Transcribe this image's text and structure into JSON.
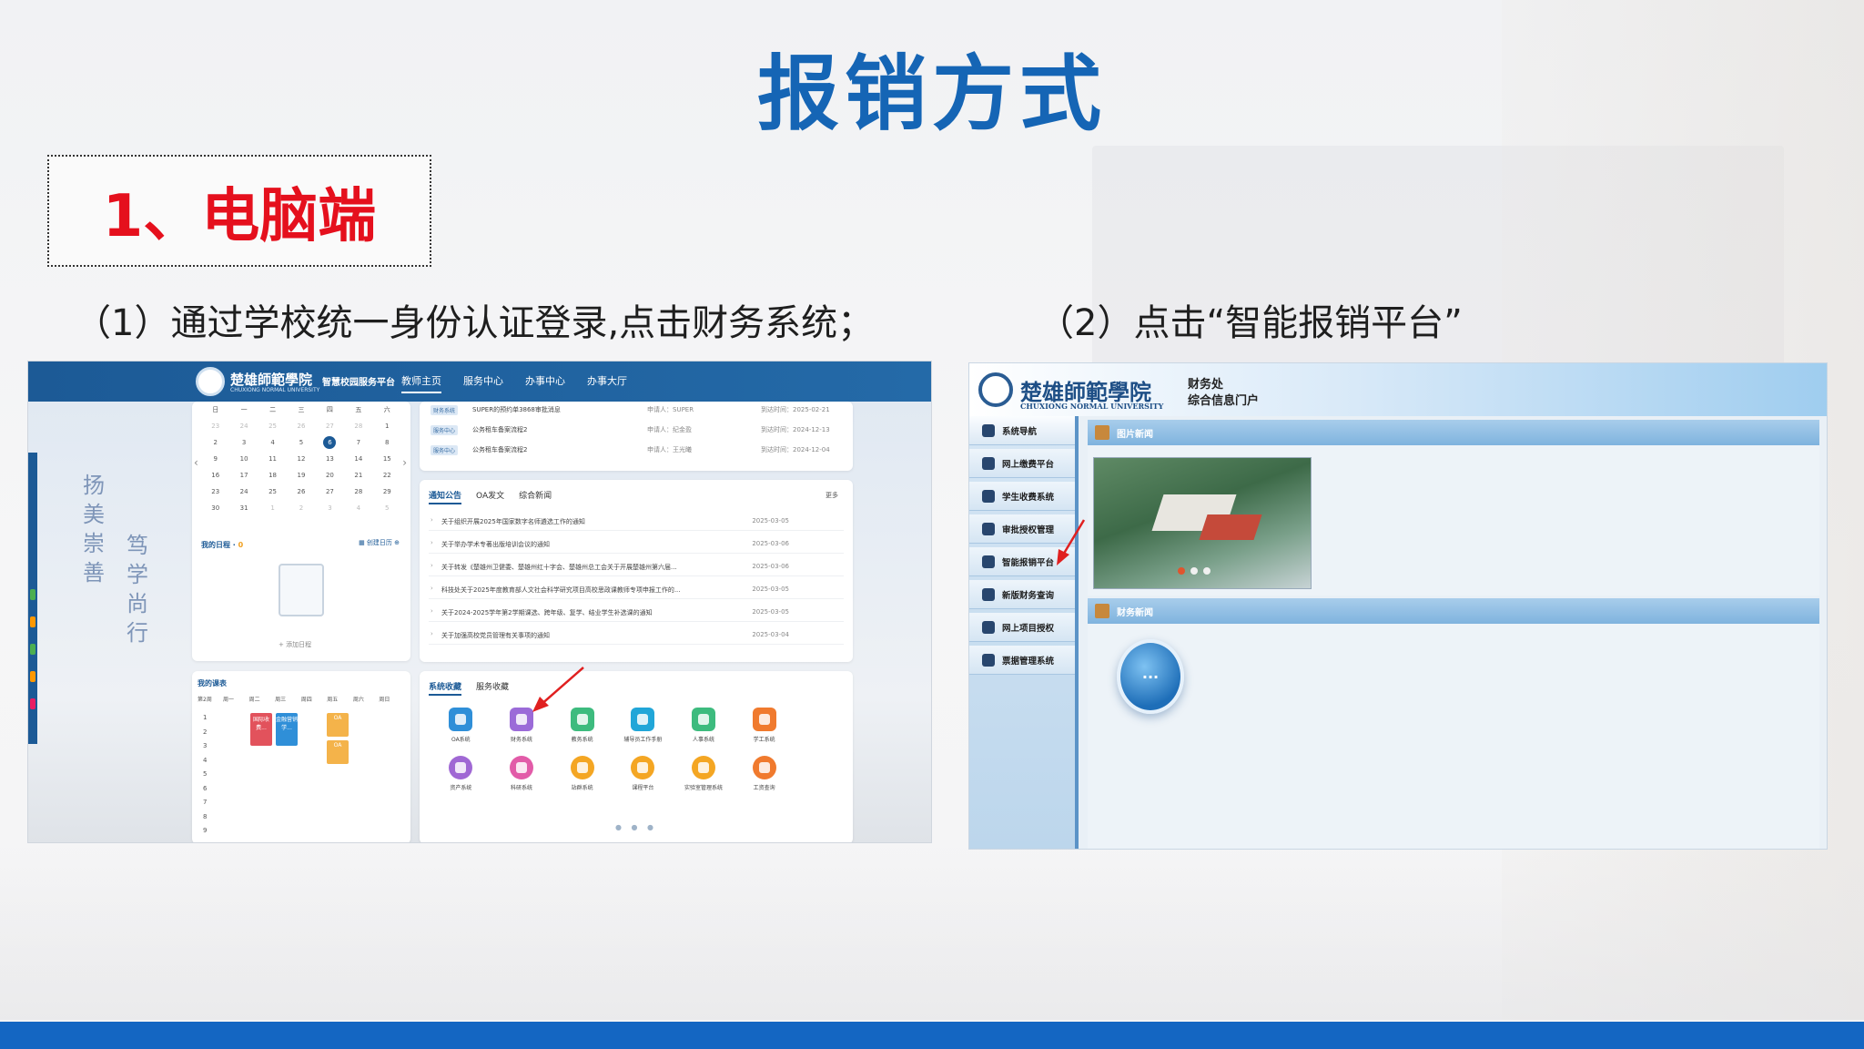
{
  "slide": {
    "title": "报销方式",
    "section": "1、电脑端",
    "step1": "（1）通过学校统一身份认证登录,点击财务系统；",
    "step2": "（2）点击“智能报销平台”"
  },
  "colors": {
    "title_blue": "#1565b5",
    "section_red": "#e5101d",
    "bottom_bar": "#1466c2",
    "portal_header": "#1c5a96"
  },
  "portal": {
    "school_name": "楚雄師範學院",
    "school_en": "CHUXIONG NORMAL UNIVERSITY",
    "platform": "智慧校园服务平台",
    "nav": [
      "教师主页",
      "服务中心",
      "办事中心",
      "办事大厅"
    ],
    "calligraphy_left": "扬美崇善",
    "calligraphy_right": "笃学尚行",
    "calendar": {
      "weekdays": [
        "日",
        "一",
        "二",
        "三",
        "四",
        "五",
        "六"
      ],
      "weeks": [
        [
          "23",
          "24",
          "25",
          "26",
          "27",
          "28",
          "1"
        ],
        [
          "2",
          "3",
          "4",
          "5",
          "6",
          "7",
          "8"
        ],
        [
          "9",
          "10",
          "11",
          "12",
          "13",
          "14",
          "15"
        ],
        [
          "16",
          "17",
          "18",
          "19",
          "20",
          "21",
          "22"
        ],
        [
          "23",
          "24",
          "25",
          "26",
          "27",
          "28",
          "29"
        ],
        [
          "30",
          "31",
          "1",
          "2",
          "3",
          "4",
          "5"
        ]
      ],
      "today": "6"
    },
    "schedule": {
      "title": "我的日程",
      "count": "0",
      "button": "创建日历",
      "add": "+ 添加日程"
    },
    "messages": [
      {
        "tag": "财务系统",
        "text": "SUPER的预约单3868审批消息",
        "person": "申请人：SUPER",
        "date": "到达时间：2025-02-21"
      },
      {
        "tag": "服务中心",
        "text": "公务租车备案流程2",
        "person": "申请人：纪金盈",
        "date": "到达时间：2024-12-13"
      },
      {
        "tag": "服务中心",
        "text": "公务租车备案流程2",
        "person": "申请人：王光曦",
        "date": "到达时间：2024-12-04"
      }
    ],
    "notice_tabs": [
      "通知公告",
      "OA发文",
      "综合新闻"
    ],
    "notice_more": "更多",
    "notices": [
      {
        "text": "关于组织开展2025年国家数字名师遴选工作的通知",
        "date": "2025-03-05"
      },
      {
        "text": "关于举办学术专著出版培训会议的通知",
        "date": "2025-03-06"
      },
      {
        "text": "关于转发《楚雄州卫健委、楚雄州红十字会、楚雄州总工会关于开展楚雄州第六届...",
        "date": "2025-03-06"
      },
      {
        "text": "科技处关于2025年度教育部人文社会科学研究项目高校思政课教师专项申报工作的...",
        "date": "2025-03-05"
      },
      {
        "text": "关于2024-2025学年第2学期课选、跨年级、复学、结业学生补选课的通知",
        "date": "2025-03-05"
      },
      {
        "text": "关于加强高校党员管理有关事项的通知",
        "date": "2025-03-04"
      }
    ],
    "course": {
      "title": "我的课表",
      "week": "第2周",
      "days": [
        "周一",
        "周二",
        "周三",
        "周四",
        "周五",
        "周六",
        "周日"
      ],
      "periods": [
        "1",
        "2",
        "3",
        "4",
        "5",
        "6",
        "7",
        "8",
        "9"
      ],
      "blocks": [
        "国际收费...",
        "金融营销学...",
        "OA",
        "OA"
      ]
    },
    "app_tabs": [
      "系统收藏",
      "服务收藏"
    ],
    "apps": [
      {
        "label": "OA系统",
        "color": "#2f8fd8"
      },
      {
        "label": "财务系统",
        "color": "#9b6bd8"
      },
      {
        "label": "教务系统",
        "color": "#3dbb7e"
      },
      {
        "label": "辅导员工作手册",
        "color": "#21a6d8"
      },
      {
        "label": "人事系统",
        "color": "#3dbb7e"
      },
      {
        "label": "学工系统",
        "color": "#f07a2e"
      },
      {
        "label": "资产系统",
        "color": "#a068d4"
      },
      {
        "label": "科研系统",
        "color": "#e25ba8"
      },
      {
        "label": "站群系统",
        "color": "#f4a623"
      },
      {
        "label": "课程平台",
        "color": "#f4a623"
      },
      {
        "label": "实验室管理系统",
        "color": "#f4a623"
      },
      {
        "label": "工资查询",
        "color": "#f07a2e"
      }
    ]
  },
  "finance": {
    "school_name": "楚雄師範學院",
    "school_en": "CHUXIONG NORMAL UNIVERSITY",
    "dept_line1": "财务处",
    "dept_line2": "综合信息门户",
    "menu": [
      "系统导航",
      "网上缴费平台",
      "学生收费系统",
      "审批授权管理",
      "智能报销平台",
      "新版财务查询",
      "网上项目授权",
      "票据管理系统"
    ],
    "panel_photo_title": "图片新闻",
    "panel_news_title": "财务新闻"
  }
}
